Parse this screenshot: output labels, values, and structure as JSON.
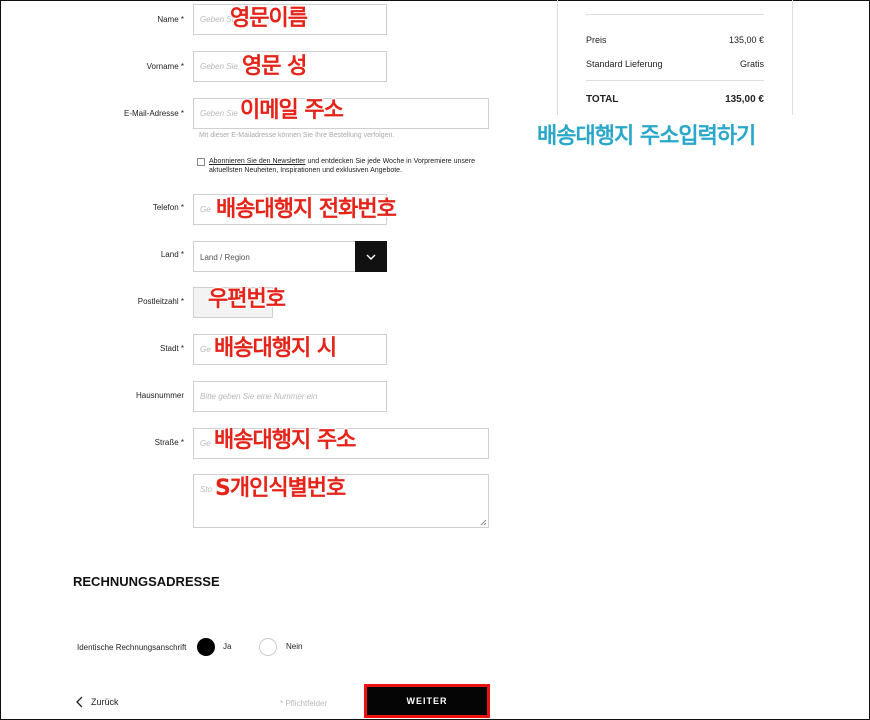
{
  "form": {
    "name": {
      "label": "Name *",
      "placeholder": "Geben Sie"
    },
    "vorname": {
      "label": "Vorname *",
      "placeholder": "Geben Sie"
    },
    "email": {
      "label": "E-Mail-Adresse *",
      "placeholder": "Geben Sie",
      "hint": "Mit dieser E-Mailadresse können Sie Ihre Bestellung verfolgen."
    },
    "newsletter": {
      "link": "Abonnieren Sie den Newsletter",
      "text": " und entdecken Sie jede Woche in Vorpremiere unsere aktuellsten Neuheiten, Inspirationen und exklusiven Angebote."
    },
    "telefon": {
      "label": "Telefon *",
      "placeholder": "Ge"
    },
    "land": {
      "label": "Land *",
      "value": "Land / Region"
    },
    "postleitzahl": {
      "label": "Postleitzahl *",
      "placeholder": ""
    },
    "stadt": {
      "label": "Stadt *",
      "placeholder": "Ge"
    },
    "hausnummer": {
      "label": "Hausnummer",
      "placeholder": "Bitte geben Sie eine Nummer ein"
    },
    "strasse": {
      "label": "Straße *",
      "placeholder": "Ge"
    },
    "zusatz": {
      "placeholder": "Sto"
    }
  },
  "annotations": {
    "name": "영문이름",
    "vorname": "영문 성",
    "email": "이메일 주소",
    "telefon": "배송대행지 전화번호",
    "postleitzahl": "우편번호",
    "stadt": "배송대행지 시",
    "strasse": "배송대행지 주소",
    "zusatz": "S개인식별번호",
    "summary": "배송대행지 주소입력하기"
  },
  "summary": {
    "preis_label": "Preis",
    "preis_value": "135,00 €",
    "lieferung_label": "Standard Lieferung",
    "lieferung_value": "Gratis",
    "total_label": "TOTAL",
    "total_value": "135,00 €"
  },
  "billing": {
    "heading": "RECHNUNGSADRESSE",
    "identical_label": "Identische Rechnungsanschrift",
    "ja": "Ja",
    "nein": "Nein",
    "selected": "Ja"
  },
  "footer": {
    "back": "Zurück",
    "required_note": "* Pflichtfelder",
    "continue": "WEITER"
  },
  "colors": {
    "annotation_red": "#e52318",
    "annotation_blue": "#2aa7c9",
    "highlight_border": "#ee1111"
  }
}
